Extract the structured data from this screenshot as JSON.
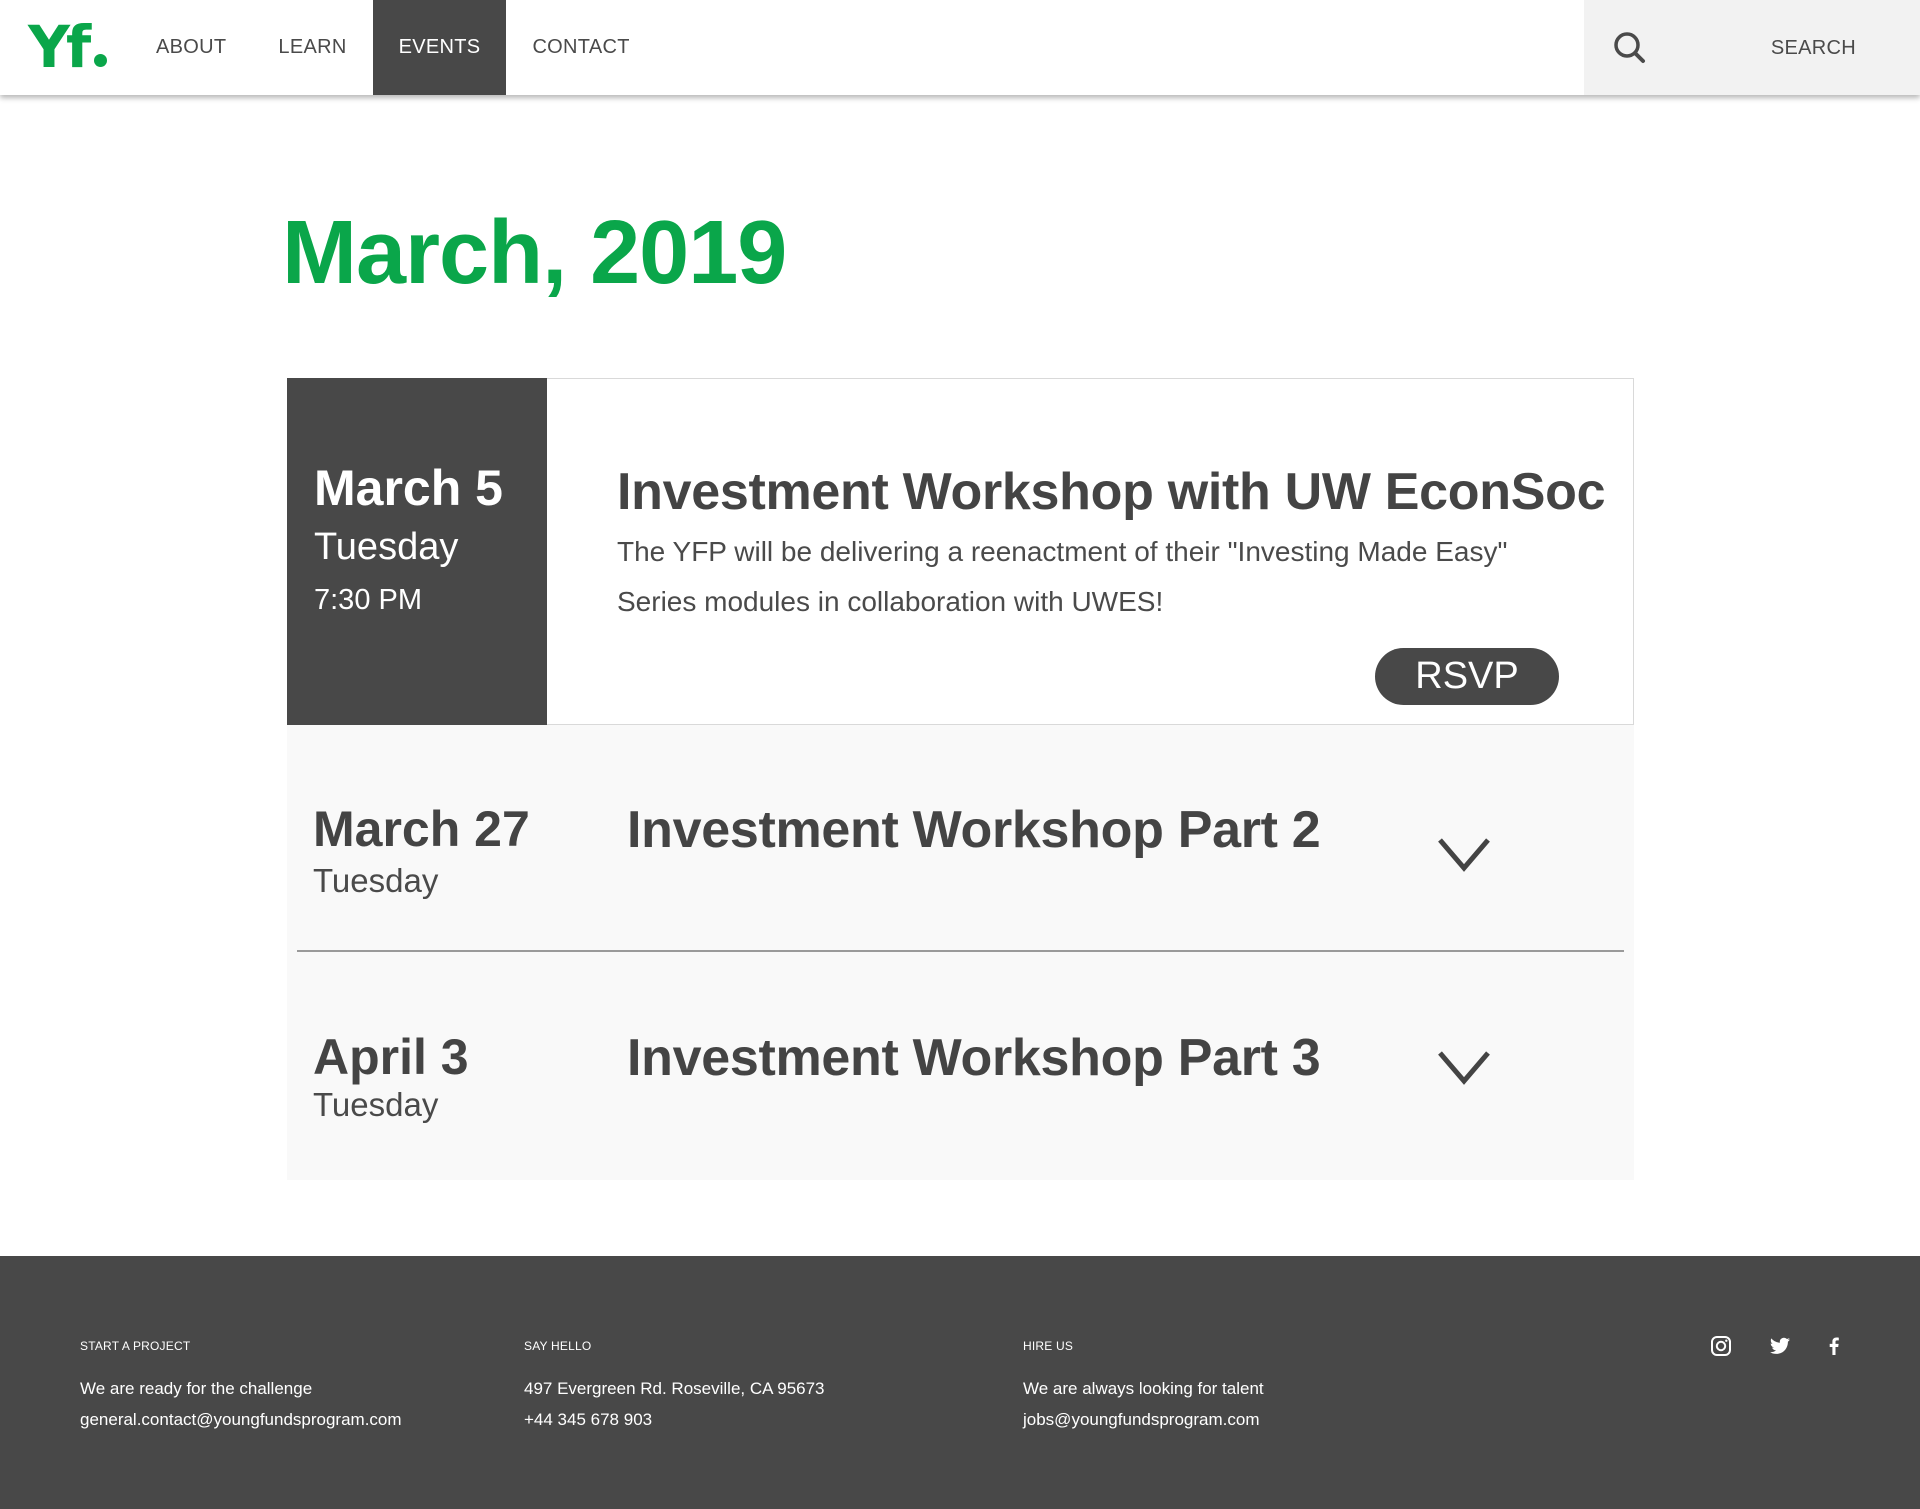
{
  "brand": {
    "logo_text": "Yf",
    "accent_color": "#0aa64a",
    "dark_color": "#484848"
  },
  "nav": {
    "items": [
      {
        "label": "ABOUT"
      },
      {
        "label": "LEARN"
      },
      {
        "label": "EVENTS",
        "active": true
      },
      {
        "label": "CONTACT"
      }
    ],
    "search_label": "SEARCH",
    "search_icon": "search-icon"
  },
  "page": {
    "title": "March, 2019"
  },
  "events": {
    "featured": {
      "date": "March 5",
      "weekday": "Tuesday",
      "time": "7:30 PM",
      "title": "Investment Workshop with UW EconSoc",
      "description": "The YFP will be delivering a reenactment of their \"Investing Made Easy\" Series modules in collaboration with UWES!",
      "rsvp_label": "RSVP"
    },
    "collapsed": [
      {
        "date": "March 27",
        "weekday": "Tuesday",
        "title": "Investment Workshop Part 2",
        "icon": "chevron-down-icon"
      },
      {
        "date": "April 3",
        "weekday": "Tuesday",
        "title": "Investment Workshop Part 3",
        "icon": "chevron-down-icon"
      }
    ]
  },
  "footer": {
    "columns": [
      {
        "heading": "START A PROJECT",
        "lines": [
          "We are ready for the challenge",
          "general.contact@youngfundsprogram.com"
        ]
      },
      {
        "heading": "SAY HELLO",
        "lines": [
          "497 Evergreen Rd. Roseville, CA 95673",
          "+44 345 678 903"
        ]
      },
      {
        "heading": "HIRE US",
        "lines": [
          "We are always looking for talent",
          "jobs@youngfundsprogram.com"
        ]
      }
    ],
    "social_icons": [
      "instagram-icon",
      "twitter-icon",
      "facebook-icon"
    ]
  }
}
